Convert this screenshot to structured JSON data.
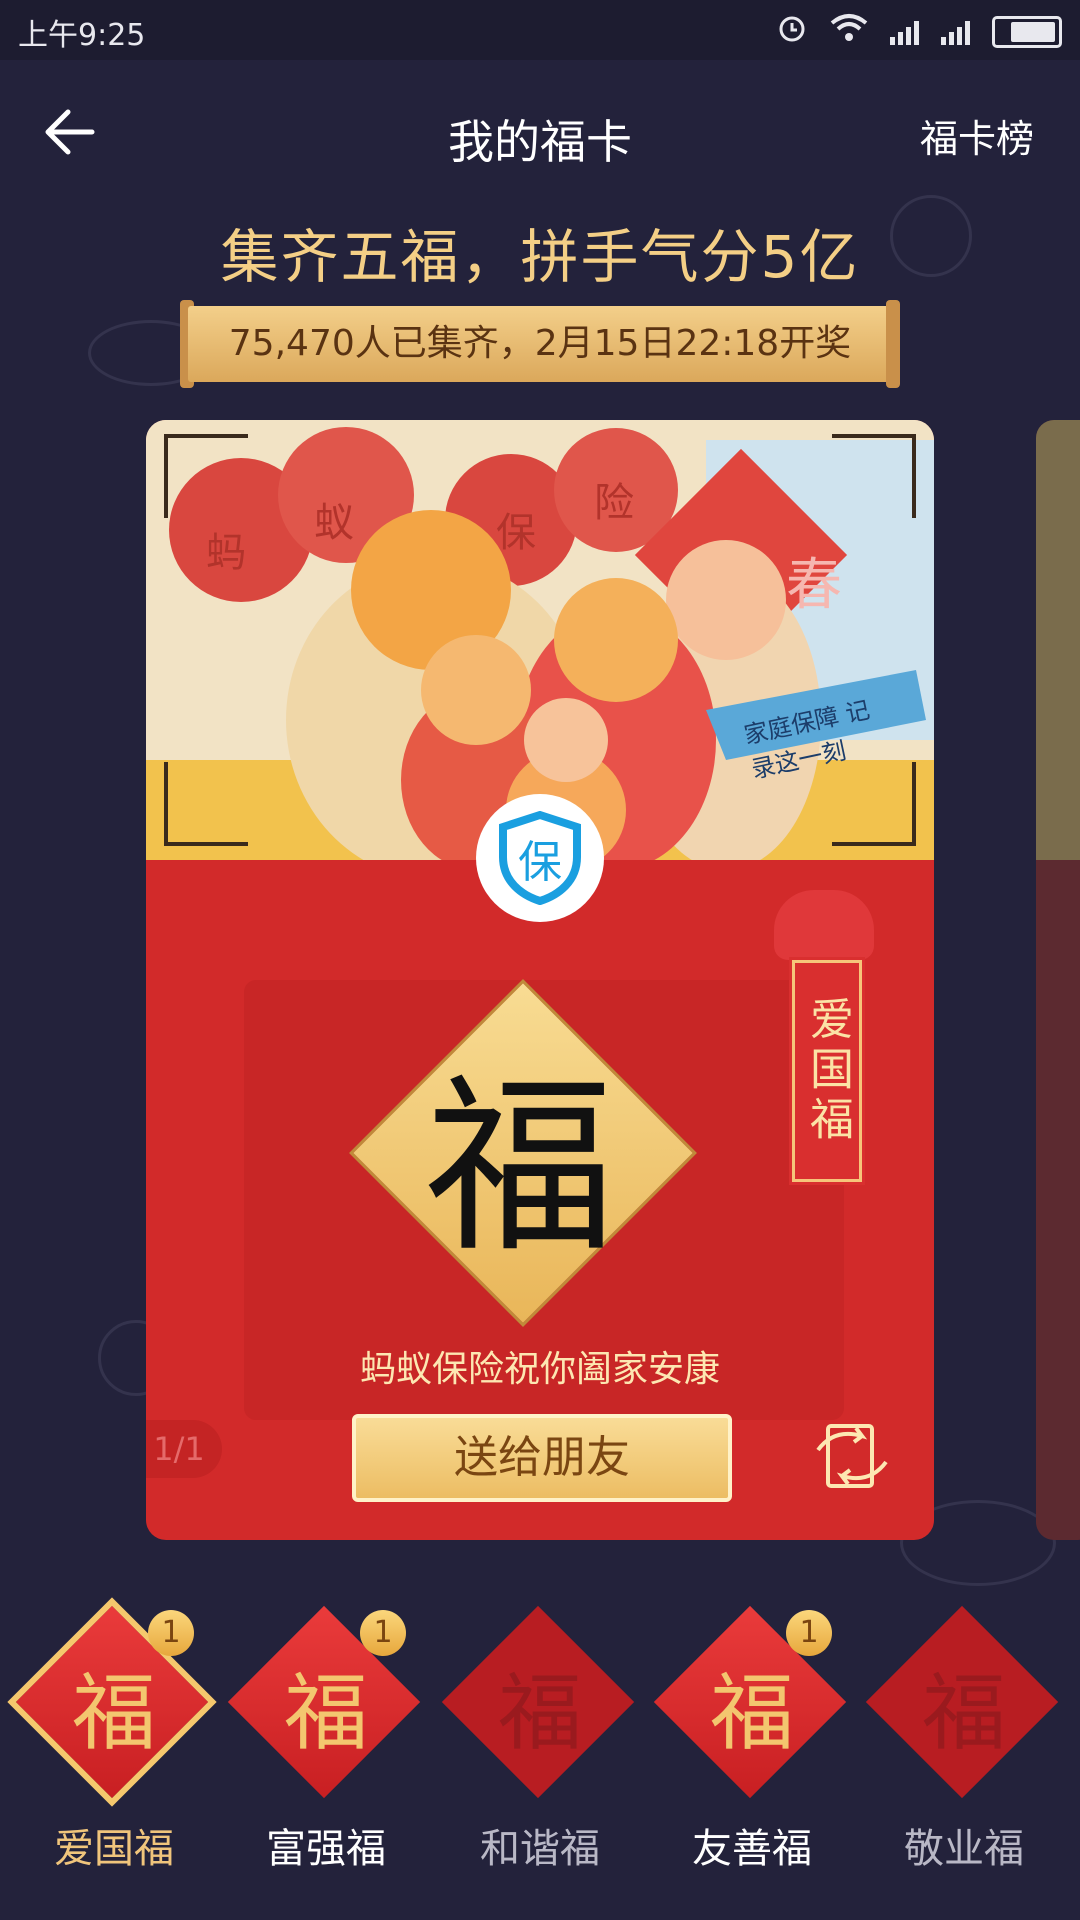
{
  "status": {
    "time": "上午9:25"
  },
  "nav": {
    "title": "我的福卡",
    "rank_link": "福卡榜"
  },
  "headline": "集齐五福，拼手气分5亿",
  "banner": "75,470人已集齐，2月15日22:18开奖",
  "card": {
    "art_chars": [
      "蚂",
      "蚁",
      "保",
      "险",
      "春"
    ],
    "art_slogan": "家庭保障 记录这一刻",
    "badge": "保",
    "main_char": "福",
    "tag": "爱国福",
    "blessing": "蚂蚁保险祝你阖家安康",
    "pager": "1/1",
    "send_label": "送给朋友"
  },
  "peek_pager": "1/",
  "fu_cards": [
    {
      "name": "爱国福",
      "char": "福",
      "count": "1",
      "owned": true,
      "selected": true
    },
    {
      "name": "富强福",
      "char": "福",
      "count": "1",
      "owned": true,
      "selected": false
    },
    {
      "name": "和谐福",
      "char": "福",
      "count": "",
      "owned": false,
      "selected": false
    },
    {
      "name": "友善福",
      "char": "福",
      "count": "1",
      "owned": true,
      "selected": false
    },
    {
      "name": "敬业福",
      "char": "福",
      "count": "",
      "owned": false,
      "selected": false
    }
  ],
  "colors": {
    "background": "#23223b",
    "gold": "#f4cf86",
    "red": "#d22a2a",
    "selected_name": "#f0c57c"
  }
}
